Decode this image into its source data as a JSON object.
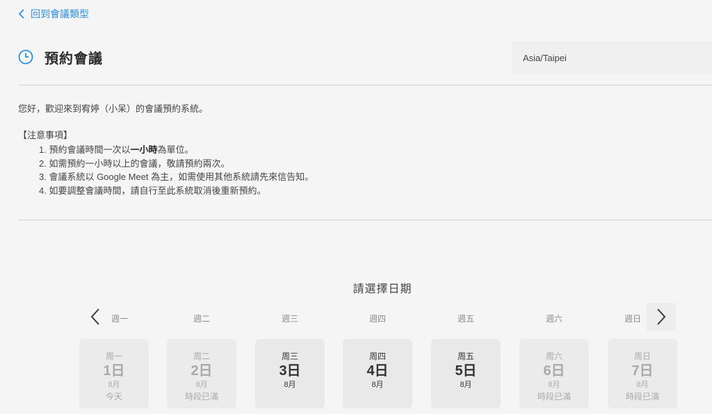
{
  "back_link": {
    "label": "回到會議類型"
  },
  "header": {
    "title": "預約會議",
    "timezone": "Asia/Taipei"
  },
  "intro": "您好，歡迎來到宥婷（小呆）的會議預約系統。",
  "notice": {
    "title": "【注意事項】",
    "items": [
      {
        "pre": "1. 預約會議時間一次以",
        "bold": "一小時",
        "post": "為單位。"
      },
      {
        "pre": "2. 如需預約一小時以上的會議，敬請預約兩次。",
        "bold": "",
        "post": ""
      },
      {
        "pre": "3. 會議系統以 Google Meet 為主，如需使用其他系統請先來信告知。",
        "bold": "",
        "post": ""
      },
      {
        "pre": "4. 如要調整會議時間，請自行至此系統取消後重新預約。",
        "bold": "",
        "post": ""
      }
    ]
  },
  "date_picker": {
    "title": "請選擇日期",
    "weekdays": [
      "週一",
      "週二",
      "週三",
      "週四",
      "週五",
      "週六",
      "週日"
    ],
    "days": [
      {
        "weekday": "周一",
        "day": "1日",
        "month": "8月",
        "status": "今天",
        "available": false
      },
      {
        "weekday": "周二",
        "day": "2日",
        "month": "8月",
        "status": "時段已滿",
        "available": false
      },
      {
        "weekday": "周三",
        "day": "3日",
        "month": "8月",
        "status": "",
        "available": true
      },
      {
        "weekday": "周四",
        "day": "4日",
        "month": "8月",
        "status": "",
        "available": true
      },
      {
        "weekday": "周五",
        "day": "5日",
        "month": "8月",
        "status": "",
        "available": true
      },
      {
        "weekday": "周六",
        "day": "6日",
        "month": "8月",
        "status": "時段已滿",
        "available": false
      },
      {
        "weekday": "周日",
        "day": "7日",
        "month": "8月",
        "status": "時段已滿",
        "available": false
      }
    ]
  },
  "colors": {
    "accent": "#2d8ed9",
    "text": "#333333",
    "muted": "#a9a9a9"
  },
  "icons": {
    "back": "chevron-left-icon",
    "clock": "clock-icon",
    "prev": "chevron-left-icon",
    "next": "chevron-right-icon"
  }
}
